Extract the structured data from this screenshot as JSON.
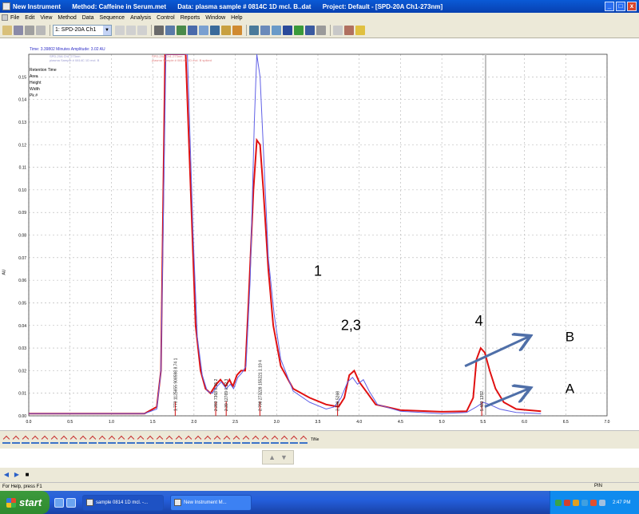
{
  "window": {
    "app_title": "New Instrument",
    "method": "Method: Caffeine in Serum.met",
    "data": "Data: plasma sample # 0814C  1D mcl. B..dat",
    "project": "Project: Default - [SPD-20A Ch1-273nm]",
    "buttons": {
      "minimize": "_",
      "maximize": "□",
      "close": "x"
    }
  },
  "menu": [
    "File",
    "Edit",
    "View",
    "Method",
    "Data",
    "Sequence",
    "Analysis",
    "Control",
    "Reports",
    "Window",
    "Help"
  ],
  "toolbar": {
    "channel": "1: SPD-20A Ch1"
  },
  "chart_header": {
    "cursor_readout": "Time: 3.39802 Minutes   Amplitude: 3.02 AU"
  },
  "legend_labels": [
    "Retention Time",
    "Area",
    "Height",
    "Width",
    "Pk #"
  ],
  "legend_entries": [
    {
      "name": "SPD-20A Ch1-273nm",
      "sub": "plasma Sample # 0814C 1D mcl. B",
      "color": "#7878e0"
    },
    {
      "name": "SPD-20A Ch1-273nm",
      "sub": "plasma Sample # 0814C 1D mcl. B spiked",
      "color": "#e01818"
    }
  ],
  "chart_data": {
    "type": "line",
    "xlabel": "",
    "ylabel": "AU",
    "xlim": [
      0,
      7
    ],
    "ylim": [
      0,
      0.16
    ],
    "x_ticks": [
      "0.0",
      "0.5",
      "1.0",
      "1.5",
      "2.0",
      "2.5",
      "3.0",
      "3.5",
      "4.0",
      "4.5",
      "5.0",
      "5.5",
      "6.0",
      "6.5",
      "7.0"
    ],
    "y_ticks": [
      "0.00",
      "0.01",
      "0.02",
      "0.03",
      "0.04",
      "0.05",
      "0.06",
      "0.07",
      "0.08",
      "0.09",
      "0.10",
      "0.11",
      "0.12",
      "0.13",
      "0.14",
      "0.15"
    ],
    "grid": true,
    "series": [
      {
        "name": "red",
        "color": "#e01010",
        "points": [
          [
            0,
            0.001
          ],
          [
            1.4,
            0.001
          ],
          [
            1.55,
            0.004
          ],
          [
            1.6,
            0.02
          ],
          [
            1.65,
            0.16
          ],
          [
            1.9,
            0.16
          ],
          [
            1.97,
            0.09
          ],
          [
            2.02,
            0.04
          ],
          [
            2.08,
            0.02
          ],
          [
            2.14,
            0.012
          ],
          [
            2.2,
            0.01
          ],
          [
            2.27,
            0.014
          ],
          [
            2.32,
            0.016
          ],
          [
            2.38,
            0.013
          ],
          [
            2.43,
            0.016
          ],
          [
            2.47,
            0.013
          ],
          [
            2.52,
            0.018
          ],
          [
            2.57,
            0.02
          ],
          [
            2.62,
            0.02
          ],
          [
            2.66,
            0.05
          ],
          [
            2.72,
            0.1
          ],
          [
            2.76,
            0.122
          ],
          [
            2.8,
            0.12
          ],
          [
            2.84,
            0.1
          ],
          [
            2.9,
            0.065
          ],
          [
            2.96,
            0.04
          ],
          [
            3.05,
            0.022
          ],
          [
            3.2,
            0.012
          ],
          [
            3.4,
            0.008
          ],
          [
            3.6,
            0.005
          ],
          [
            3.75,
            0.004
          ],
          [
            3.82,
            0.008
          ],
          [
            3.88,
            0.018
          ],
          [
            3.94,
            0.02
          ],
          [
            4.0,
            0.015
          ],
          [
            4.1,
            0.01
          ],
          [
            4.2,
            0.005
          ],
          [
            4.5,
            0.0025
          ],
          [
            5.0,
            0.0018
          ],
          [
            5.3,
            0.002
          ],
          [
            5.38,
            0.008
          ],
          [
            5.42,
            0.025
          ],
          [
            5.47,
            0.03
          ],
          [
            5.52,
            0.028
          ],
          [
            5.58,
            0.02
          ],
          [
            5.65,
            0.012
          ],
          [
            5.75,
            0.006
          ],
          [
            5.9,
            0.003
          ],
          [
            6.2,
            0.002
          ]
        ]
      },
      {
        "name": "blue",
        "color": "#6060e6",
        "points": [
          [
            0,
            0.001
          ],
          [
            1.4,
            0.001
          ],
          [
            1.55,
            0.003
          ],
          [
            1.6,
            0.02
          ],
          [
            1.66,
            0.16
          ],
          [
            1.92,
            0.16
          ],
          [
            1.99,
            0.08
          ],
          [
            2.04,
            0.035
          ],
          [
            2.1,
            0.018
          ],
          [
            2.16,
            0.011
          ],
          [
            2.22,
            0.01
          ],
          [
            2.28,
            0.013
          ],
          [
            2.33,
            0.015
          ],
          [
            2.39,
            0.012
          ],
          [
            2.44,
            0.014
          ],
          [
            2.48,
            0.012
          ],
          [
            2.53,
            0.017
          ],
          [
            2.58,
            0.019
          ],
          [
            2.63,
            0.022
          ],
          [
            2.68,
            0.06
          ],
          [
            2.73,
            0.13
          ],
          [
            2.76,
            0.16
          ],
          [
            2.8,
            0.15
          ],
          [
            2.85,
            0.11
          ],
          [
            2.9,
            0.07
          ],
          [
            2.97,
            0.045
          ],
          [
            3.05,
            0.025
          ],
          [
            3.2,
            0.011
          ],
          [
            3.4,
            0.006
          ],
          [
            3.6,
            0.003
          ],
          [
            3.7,
            0.004
          ],
          [
            3.78,
            0.008
          ],
          [
            3.86,
            0.015
          ],
          [
            3.92,
            0.017
          ],
          [
            3.98,
            0.014
          ],
          [
            4.05,
            0.016
          ],
          [
            4.12,
            0.011
          ],
          [
            4.22,
            0.005
          ],
          [
            4.5,
            0.002
          ],
          [
            5.0,
            0.001
          ],
          [
            5.3,
            0.0015
          ],
          [
            5.42,
            0.004
          ],
          [
            5.5,
            0.006
          ],
          [
            5.58,
            0.005
          ],
          [
            5.7,
            0.003
          ],
          [
            5.9,
            0.0015
          ],
          [
            6.2,
            0.001
          ]
        ]
      }
    ],
    "peak_annotations": [
      {
        "x": 1.773,
        "text": "1.773  1125655  908598  8.74  1"
      },
      {
        "x": 2.263,
        "text": "2.283  7368  0.15  2"
      },
      {
        "x": 2.39,
        "text": "2.39  12769  0.12  3"
      },
      {
        "x": 2.798,
        "text": "2.798  273228  155221  1.19  4"
      },
      {
        "x": 3.738,
        "text": "3.738  5268"
      },
      {
        "x": 5.483,
        "text": "5.483  1352"
      }
    ],
    "overlay_labels": [
      {
        "text": "1",
        "x": 3.5,
        "y": 0.062
      },
      {
        "text": "2,3",
        "x": 3.9,
        "y": 0.038
      },
      {
        "text": "4",
        "x": 5.45,
        "y": 0.04
      },
      {
        "text": "B",
        "x": 6.55,
        "y": 0.033
      },
      {
        "text": "A",
        "x": 6.55,
        "y": 0.01
      }
    ],
    "overlay_arrows": [
      {
        "from": [
          5.28,
          0.022
        ],
        "to": [
          6.05,
          0.035
        ]
      },
      {
        "from": [
          5.52,
          0.004
        ],
        "to": [
          6.05,
          0.012
        ]
      }
    ]
  },
  "bottom_toolbar": {
    "last_label": "TiNe"
  },
  "status": {
    "message": "For Help, press F1",
    "pin": "PIN"
  },
  "taskbar": {
    "start": "start",
    "tasks": [
      "sample 0814 1D mcl. -...",
      "New Instrument  M..."
    ],
    "clock": "2:47 PM"
  }
}
